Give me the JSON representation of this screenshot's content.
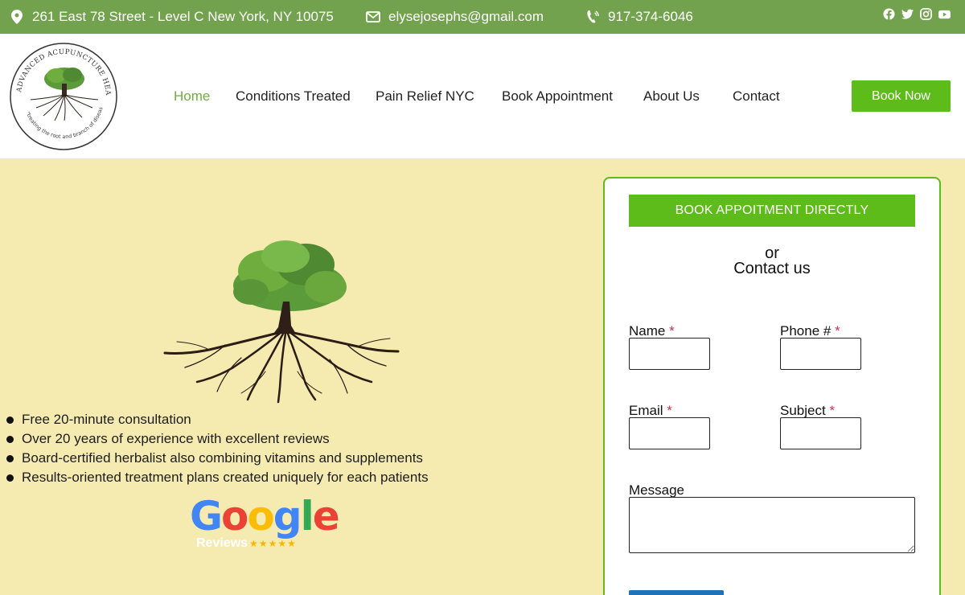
{
  "topbar": {
    "address": "261 East 78 Street - Level C New York, NY 10075",
    "email": "elysejosephs@gmail.com",
    "phone": "917-374-6046",
    "background": "#73a24e",
    "icons": [
      "map-pin-icon",
      "envelope-icon",
      "phone-icon"
    ],
    "social": [
      "facebook-icon",
      "twitter-icon",
      "instagram-icon",
      "youtube-icon"
    ]
  },
  "logo": {
    "arc_text": "ADVANCED ACUPUNCTURE HEALTH",
    "tagline": "\"treating the root and branch of disease\""
  },
  "nav": {
    "items": [
      {
        "label": "Home",
        "active": true
      },
      {
        "label": "Conditions Treated",
        "active": false
      },
      {
        "label": "Pain Relief NYC",
        "active": false
      },
      {
        "label": "Book Appointment",
        "active": false
      },
      {
        "label": "About Us",
        "active": false
      },
      {
        "label": "Contact",
        "active": false
      }
    ],
    "cta": "Book Now",
    "accent": "#5dbb1a"
  },
  "hero": {
    "background": "#f5ebb1",
    "features": [
      "Free 20-minute consultation",
      "Over 20 years of experience with excellent reviews",
      "Board-certified herbalist also combining vitamins and supplements",
      "Results-oriented treatment plans created uniquely for each patients"
    ],
    "google": {
      "word": "Google",
      "sub": "Reviews",
      "stars": "★★★★★"
    }
  },
  "form": {
    "direct_button": "BOOK APPOITMENT DIRECTLY",
    "or": "or",
    "contact": "Contact us",
    "name_label": "Name",
    "phone_label": "Phone #",
    "email_label": "Email",
    "subject_label": "Subject",
    "message_label": "Message",
    "required_mark": "*",
    "name_value": "",
    "phone_value": "",
    "email_value": "",
    "subject_value": "",
    "message_value": ""
  }
}
